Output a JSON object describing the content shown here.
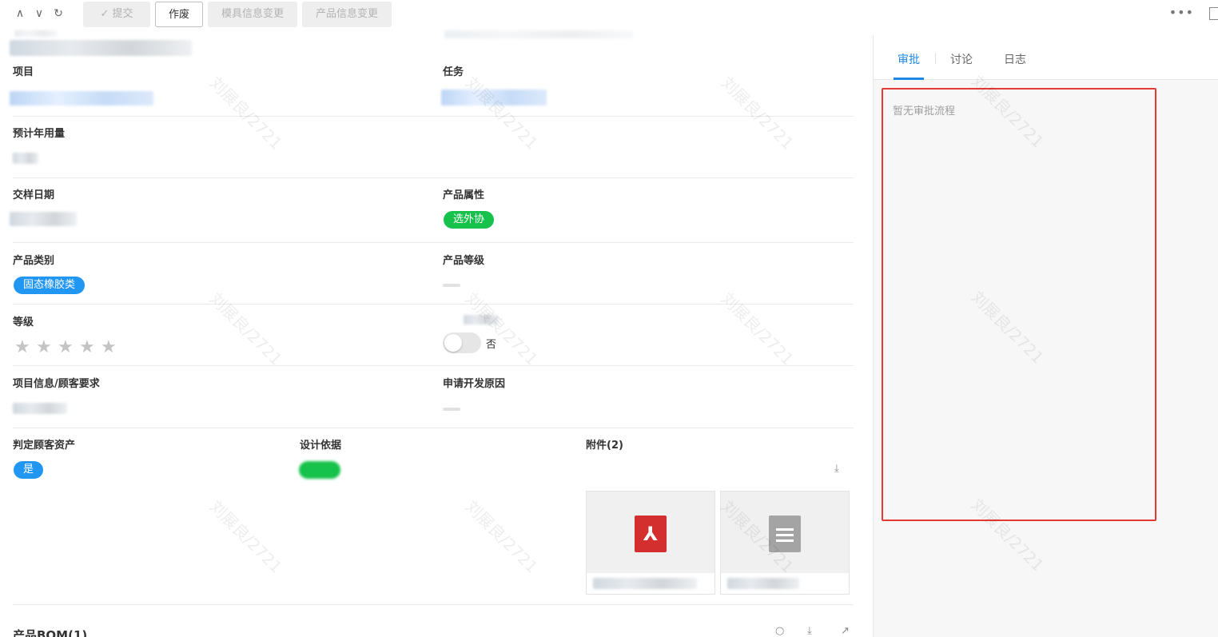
{
  "toolbar": {
    "submit_label": "✓ 提交",
    "void_label": "作废",
    "mold_change_label": "模具信息变更",
    "product_change_label": "产品信息变更"
  },
  "form": {
    "project_label": "项目",
    "task_label": "任务",
    "annual_usage_label": "预计年用量",
    "sample_date_label": "交样日期",
    "product_attr_label": "产品属性",
    "product_attr_value": "选外协",
    "product_category_label": "产品类别",
    "product_category_value": "固态橡胶类",
    "product_grade_label": "产品等级",
    "level_label": "等级",
    "level_value": 0,
    "level_max": 5,
    "toggle_text": "否",
    "project_info_label": "项目信息/顾客要求",
    "apply_reason_label": "申请开发原因",
    "customer_asset_label": "判定顾客资产",
    "customer_asset_value": "是",
    "design_basis_label": "设计依据",
    "attachments_label": "附件(2)"
  },
  "bom": {
    "title": "产品BOM(1)"
  },
  "right_panel": {
    "tabs": [
      "审批",
      "讨论",
      "日志"
    ],
    "active_tab": 0,
    "empty_text": "暂无审批流程"
  },
  "watermark_text": "刘展良/2721"
}
